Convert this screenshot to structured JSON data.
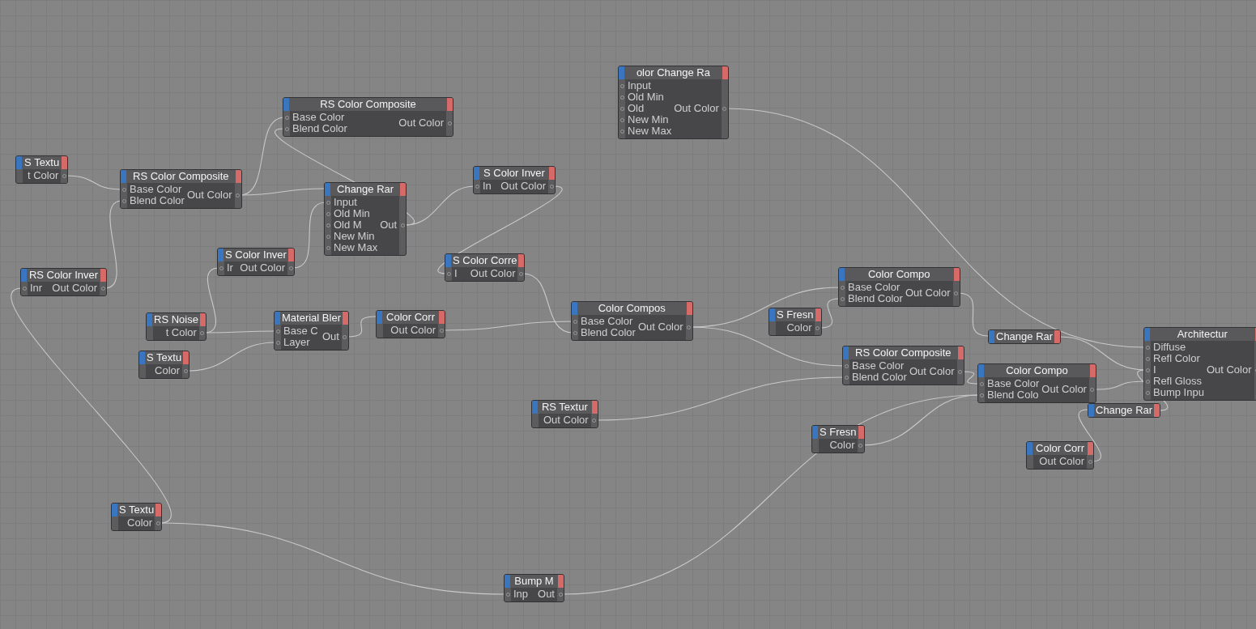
{
  "node_editor": {
    "nodes": [
      {
        "title": "S Textu",
        "outputs": [
          "t Color"
        ]
      },
      {
        "title": "RS Color Composite",
        "inputs": [
          "Base Color",
          "Blend Color"
        ],
        "outputs": [
          "Out Color"
        ]
      },
      {
        "title": "RS Color Composite",
        "inputs": [
          "Base Color",
          "Blend Color"
        ],
        "outputs": [
          "Out Color"
        ]
      },
      {
        "title": "olor Change Ra",
        "inputs": [
          "Input",
          "Old Min",
          "Old",
          "New Min",
          "New Max"
        ],
        "outputs": [
          "Out Color"
        ]
      },
      {
        "title": "Change Rar",
        "inputs": [
          "Input",
          "Old Min",
          "Old M",
          "New Min",
          "New Max"
        ],
        "outputs": [
          "Out"
        ]
      },
      {
        "title": "S Color Inver",
        "inputs": [
          "In"
        ],
        "outputs": [
          "Out Color"
        ]
      },
      {
        "title": "RS Color Inver",
        "inputs": [
          "Inr"
        ],
        "outputs": [
          "Out Color"
        ]
      },
      {
        "title": "S Color Inver",
        "inputs": [
          "Ir"
        ],
        "outputs": [
          "Out Color"
        ]
      },
      {
        "title": "S Color Corre",
        "inputs": [
          "I"
        ],
        "outputs": [
          "Out Color"
        ]
      },
      {
        "title": "RS Noise",
        "outputs": [
          "t Color"
        ]
      },
      {
        "title": "S Textu",
        "outputs": [
          "Color"
        ]
      },
      {
        "title": "Material Bler",
        "inputs": [
          "Base C",
          "Layer"
        ],
        "outputs": [
          "Out"
        ]
      },
      {
        "title": "Color Corr",
        "outputs": [
          "Out Color"
        ]
      },
      {
        "title": "Color Compos",
        "inputs": [
          "Base Color",
          "Blend Color"
        ],
        "outputs": [
          "Out Color"
        ]
      },
      {
        "title": "S Fresn",
        "outputs": [
          "Color"
        ]
      },
      {
        "title": "Color Compo",
        "inputs": [
          "Base Color",
          "Blend Color"
        ],
        "outputs": [
          "Out Color"
        ]
      },
      {
        "title": "Change Rar"
      },
      {
        "title": "RS Color Composite",
        "inputs": [
          "Base Color",
          "Blend Color"
        ],
        "outputs": [
          "Out Color"
        ]
      },
      {
        "title": "Color Compo",
        "inputs": [
          "Base Color",
          "Blend Colo"
        ],
        "outputs": [
          "Out Color"
        ]
      },
      {
        "title": "Architectur",
        "inputs": [
          "Diffuse",
          "Refl Color",
          "I",
          "Refl Gloss",
          "Bump Inpu"
        ],
        "outputs": [
          "Out Color"
        ]
      },
      {
        "title": "Change Rar"
      },
      {
        "title": "RS Textur",
        "outputs": [
          "Out Color"
        ]
      },
      {
        "title": "S Fresn",
        "outputs": [
          "Color"
        ]
      },
      {
        "title": "Color Corr",
        "outputs": [
          "Out Color"
        ]
      },
      {
        "title": "S Textu",
        "outputs": [
          "Color"
        ]
      },
      {
        "title": "Bump M",
        "inputs": [
          "Inp"
        ],
        "outputs": [
          "Out"
        ]
      }
    ]
  }
}
